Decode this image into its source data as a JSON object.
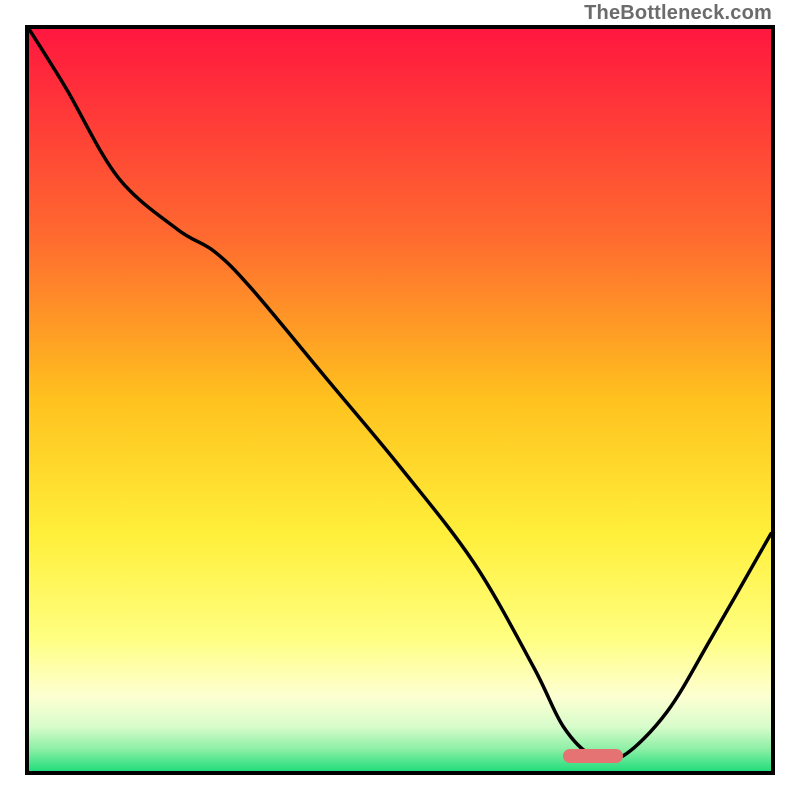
{
  "watermark": "TheBottleneck.com",
  "colors": {
    "top": "#ff173f",
    "mid_upper": "#ff8a2a",
    "mid": "#ffd21a",
    "mid_lower": "#ffff66",
    "pale": "#fdffcf",
    "green_light": "#b6f7b0",
    "green": "#2de07e",
    "curve": "#000000",
    "marker": "#e57373",
    "border": "#000000"
  },
  "chart_data": {
    "type": "line",
    "title": "",
    "xlabel": "",
    "ylabel": "",
    "xlim": [
      0,
      100
    ],
    "ylim": [
      0,
      100
    ],
    "series": [
      {
        "name": "bottleneck-curve",
        "x": [
          0,
          5,
          12,
          20,
          25,
          30,
          40,
          50,
          60,
          68,
          72,
          76,
          80,
          86,
          92,
          100
        ],
        "values": [
          100,
          92,
          80,
          73,
          70,
          65,
          53,
          41,
          28,
          14,
          6,
          2,
          2,
          8,
          18,
          32
        ]
      }
    ],
    "annotations": [
      {
        "name": "optimal-range-marker",
        "x_start": 72,
        "x_end": 80,
        "y": 2
      }
    ],
    "gradient_stops": [
      {
        "offset": 0.0,
        "color": "#ff173f"
      },
      {
        "offset": 0.28,
        "color": "#ff6a2f"
      },
      {
        "offset": 0.5,
        "color": "#ffc21e"
      },
      {
        "offset": 0.68,
        "color": "#ffef3a"
      },
      {
        "offset": 0.82,
        "color": "#ffff80"
      },
      {
        "offset": 0.9,
        "color": "#fdffd2"
      },
      {
        "offset": 0.94,
        "color": "#d8fccb"
      },
      {
        "offset": 0.97,
        "color": "#8ef0a6"
      },
      {
        "offset": 1.0,
        "color": "#23dd7c"
      }
    ]
  }
}
